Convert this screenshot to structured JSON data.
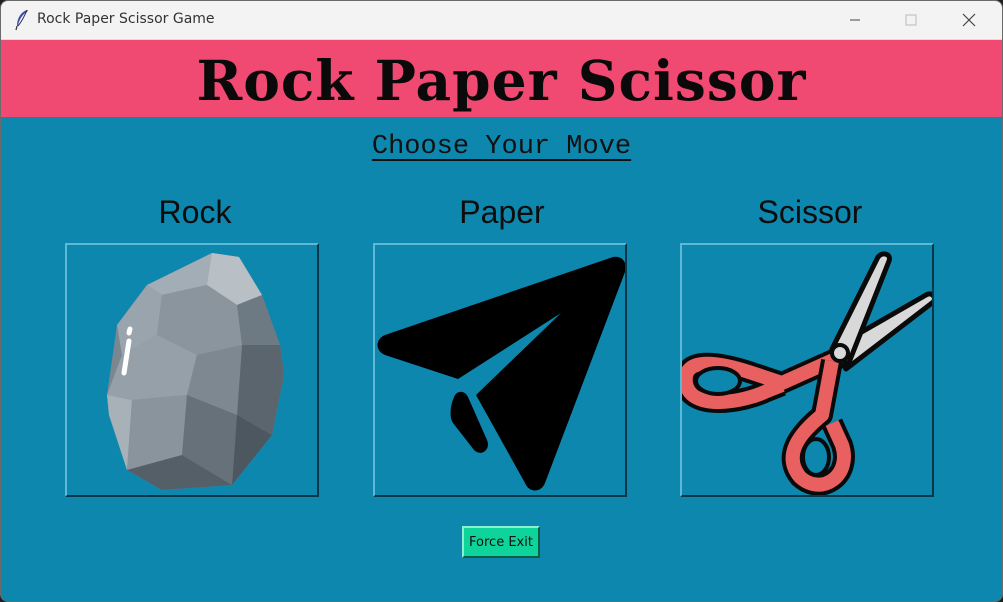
{
  "window": {
    "title": "Rock Paper Scissor Game",
    "app_icon": "feather-icon"
  },
  "banner": {
    "title": "Rock Paper Scissor",
    "color": "#f14a72"
  },
  "prompt": "Choose Your Move",
  "choices": [
    {
      "label": "Rock",
      "icon": "rock-icon"
    },
    {
      "label": "Paper",
      "icon": "paper-plane-icon"
    },
    {
      "label": "Scissor",
      "icon": "scissors-icon"
    }
  ],
  "exit_button": {
    "label": "Force Exit",
    "color": "#0ed39a"
  },
  "colors": {
    "background": "#0e87ae",
    "scissor_handle": "#e8605f"
  }
}
